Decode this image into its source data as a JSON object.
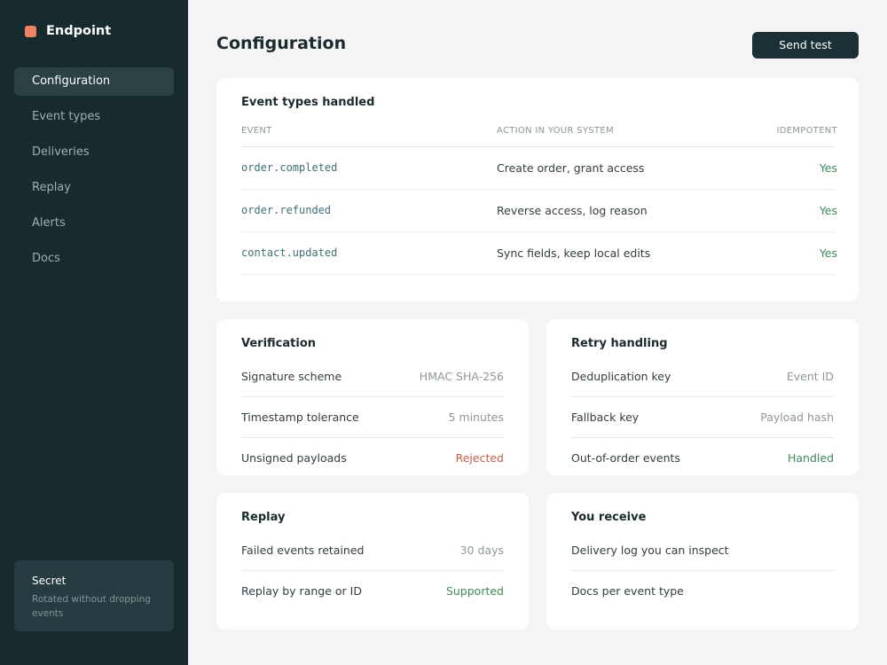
{
  "sidebar": {
    "brand": "Endpoint",
    "items": [
      {
        "label": "Configuration",
        "active": true
      },
      {
        "label": "Event types"
      },
      {
        "label": "Deliveries"
      },
      {
        "label": "Replay"
      },
      {
        "label": "Alerts"
      },
      {
        "label": "Docs"
      }
    ],
    "secret": {
      "title": "Secret",
      "text": "Rotated without dropping events"
    }
  },
  "header": {
    "title": "Configuration",
    "send_test_label": "Send test"
  },
  "events": {
    "title": "Event types handled",
    "columns": [
      "EVENT",
      "ACTION IN YOUR SYSTEM",
      "IDEMPOTENT"
    ],
    "rows": [
      {
        "event": "order.completed",
        "action": "Create order, grant access",
        "idempotent": "Yes"
      },
      {
        "event": "order.refunded",
        "action": "Reverse access, log reason",
        "idempotent": "Yes"
      },
      {
        "event": "contact.updated",
        "action": "Sync fields, keep local edits",
        "idempotent": "Yes"
      }
    ]
  },
  "verification": {
    "title": "Verification",
    "rows": [
      {
        "key": "Signature scheme",
        "value": "HMAC SHA-256"
      },
      {
        "key": "Timestamp tolerance",
        "value": "5 minutes"
      },
      {
        "key": "Unsigned payloads",
        "value": "Rejected"
      }
    ]
  },
  "retry": {
    "title": "Retry handling",
    "rows": [
      {
        "key": "Deduplication key",
        "value": "Event ID"
      },
      {
        "key": "Fallback key",
        "value": "Payload hash"
      },
      {
        "key": "Out-of-order events",
        "value": "Handled"
      }
    ]
  },
  "replay": {
    "title": "Replay",
    "rows": [
      {
        "key": "Failed events retained",
        "value": "30 days"
      },
      {
        "key": "Replay by range or ID",
        "value": "Supported"
      }
    ]
  },
  "receive": {
    "title": "You receive",
    "rows": [
      {
        "key": "Delivery log you can inspect"
      },
      {
        "key": "Docs per event type"
      }
    ]
  },
  "colors": {
    "sidebar_bg": "#172a2e",
    "brand_accent": "#ee8466",
    "success": "#3f8a5a",
    "danger": "#c65f49",
    "mono_text": "#3f6f78"
  },
  "icons": {
    "brand": "brand-logo-icon"
  }
}
